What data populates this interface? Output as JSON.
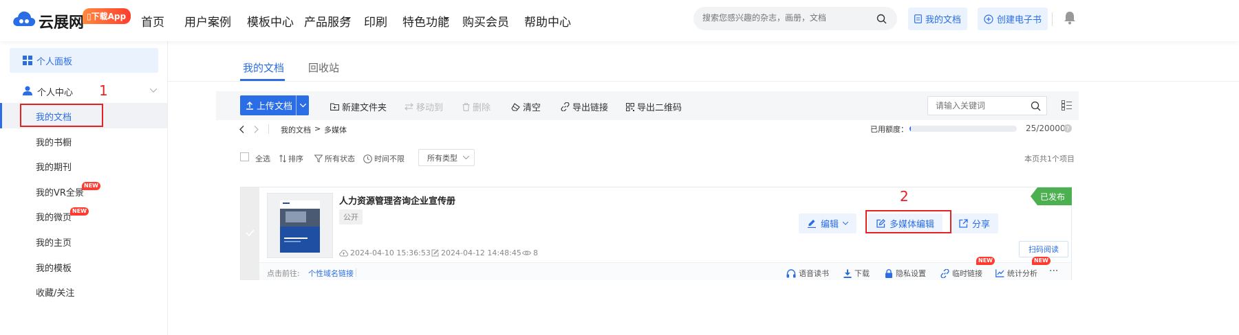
{
  "header": {
    "logo": "云展网",
    "download_app": "下载App",
    "nav": [
      "首页",
      "用户案例",
      "模板中心",
      "产品服务",
      "印刷",
      "特色功能",
      "购买会员",
      "帮助中心"
    ],
    "search_placeholder": "搜索您感兴趣的杂志，画册，文档",
    "my_docs_btn": "我的文档",
    "create_btn": "创建电子书"
  },
  "sidebar": {
    "panel": "个人面板",
    "center": "个人中心",
    "items": [
      "我的文档",
      "我的书橱",
      "我的期刊",
      "我的VR全景",
      "我的微页",
      "我的主页",
      "我的模板",
      "收藏/关注"
    ],
    "new_label": "NEW"
  },
  "annotations": {
    "num1": "1",
    "num2": "2"
  },
  "tabs": [
    "我的文档",
    "回收站"
  ],
  "toolbar": {
    "upload": "上传文档",
    "new_folder": "新建文件夹",
    "move_to": "移动到",
    "delete": "删除",
    "clear": "清空",
    "export_link": "导出链接",
    "export_qr": "导出二维码",
    "keyword_placeholder": "请输入关键词"
  },
  "breadcrumb": {
    "root": "我的文档",
    "sep": ">",
    "current": "多媒体"
  },
  "quota": {
    "label": "已用额度：",
    "used": 25,
    "total": 20000,
    "text": "25/20000"
  },
  "filters": {
    "select_all": "全选",
    "sort": "排序",
    "status": "所有状态",
    "time": "时间不限",
    "type": "所有类型",
    "count": "本页共1个项目"
  },
  "doc": {
    "title": "人力资源管理咨询企业宣传册",
    "visibility": "公开",
    "created": "2024-04-10 15:36:53",
    "modified": "2024-04-12 14:48:45",
    "views": "8",
    "status": "已发布",
    "edit": "编辑",
    "multimedia_edit": "多媒体编辑",
    "share": "分享",
    "scan_read": "扫码阅读",
    "footer_label": "点击前往:",
    "custom_domain": "个性域名链接",
    "footer_actions": [
      "语音读书",
      "下载",
      "隐私设置",
      "临时链接",
      "统计分析"
    ],
    "more": "···"
  },
  "colors": {
    "accent": "#2b6de5",
    "annotation": "#e52121",
    "published": "#4caf50"
  }
}
